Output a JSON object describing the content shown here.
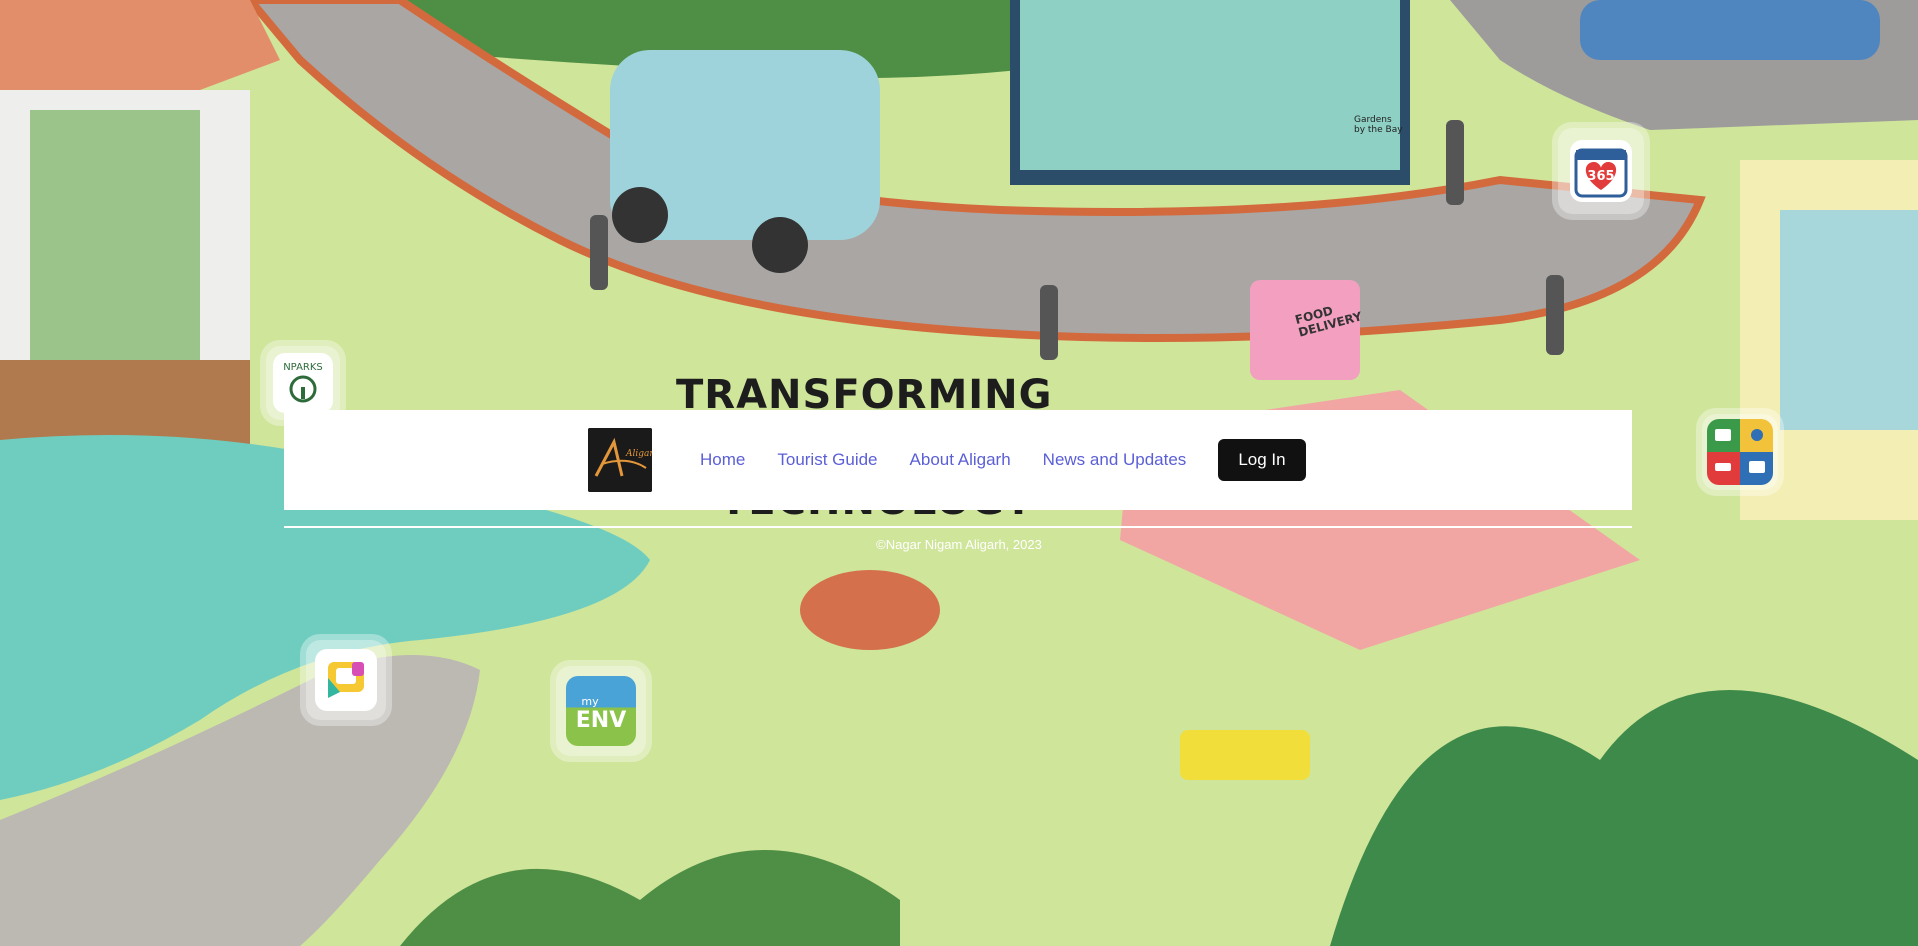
{
  "nav": {
    "logo_text": "Aligarh",
    "links": [
      "Home",
      "Tourist Guide",
      "About Aligarh",
      "News and Updates"
    ],
    "login_label": "Log In"
  },
  "background": {
    "headline_line1": "TRANSFORMING",
    "headline_line2": "TECHNOLOGY",
    "apps": {
      "calendar_label": "365",
      "nparks_label": "NPARKS",
      "myenv_small": "my",
      "myenv_big": "ENV"
    },
    "signs": {
      "food_delivery": "FOOD DELIVERY",
      "gardens": "Gardens by the Bay"
    }
  },
  "footer": {
    "copyright": "©Nagar Nigam Aligarh, 2023"
  },
  "colors": {
    "nav_link": "#5b5fd6",
    "login_bg": "#111111",
    "grass": "#cfe59a",
    "path": "#a9a6a4",
    "pond": "#6fcdbf"
  }
}
